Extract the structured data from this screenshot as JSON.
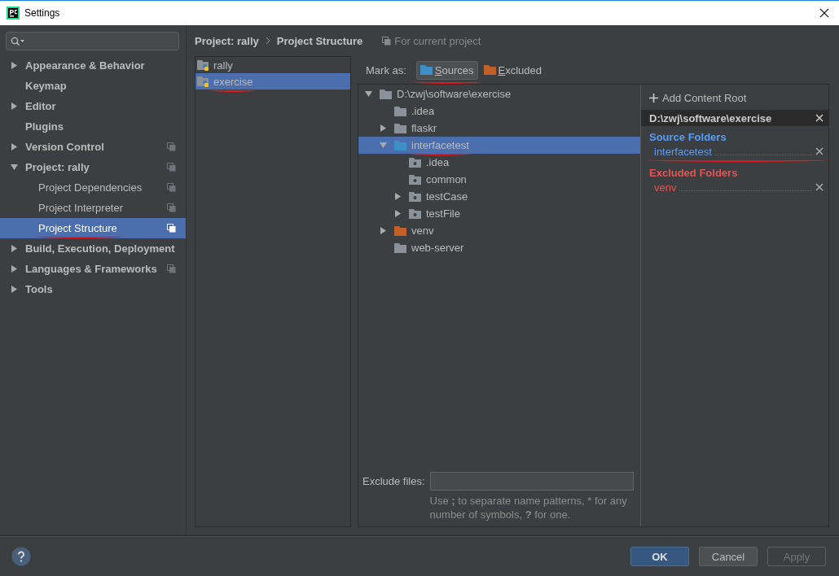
{
  "window": {
    "title": "Settings"
  },
  "sidebar": {
    "items": [
      {
        "label": "Appearance & Behavior",
        "expanded": false,
        "selected": false,
        "project_scope": false,
        "underlined": false
      },
      {
        "label": "Keymap",
        "selected": false,
        "project_scope": false,
        "underlined": false
      },
      {
        "label": "Editor",
        "expanded": false,
        "selected": false,
        "project_scope": false,
        "underlined": false
      },
      {
        "label": "Plugins",
        "selected": false,
        "project_scope": false,
        "underlined": false
      },
      {
        "label": "Version Control",
        "expanded": false,
        "selected": false,
        "project_scope": true,
        "underlined": false
      },
      {
        "label": "Project: rally",
        "expanded": true,
        "selected": false,
        "project_scope": true,
        "underlined": false,
        "children": [
          {
            "label": "Project Dependencies",
            "selected": false,
            "project_scope": true,
            "underlined": false
          },
          {
            "label": "Project Interpreter",
            "selected": false,
            "project_scope": true,
            "underlined": false
          },
          {
            "label": "Project Structure",
            "selected": true,
            "project_scope": true,
            "underlined": true
          }
        ]
      },
      {
        "label": "Build, Execution, Deployment",
        "expanded": false,
        "selected": false,
        "project_scope": false,
        "underlined": false
      },
      {
        "label": "Languages & Frameworks",
        "expanded": false,
        "selected": false,
        "project_scope": true,
        "underlined": false
      },
      {
        "label": "Tools",
        "expanded": false,
        "selected": false,
        "project_scope": false,
        "underlined": false
      }
    ]
  },
  "breadcrumb": [
    "Project: rally",
    "Project Structure"
  ],
  "scope_note": "For current project",
  "modules": [
    {
      "name": "rally",
      "selected": false,
      "underlined": false
    },
    {
      "name": "exercise",
      "selected": true,
      "underlined": true
    }
  ],
  "mark_as": {
    "label": "Mark as:",
    "buttons": [
      {
        "label": "Sources",
        "kind": "source",
        "selected": true,
        "underlined": true
      },
      {
        "label": "Excluded",
        "kind": "excluded",
        "selected": false,
        "underlined": false
      }
    ]
  },
  "tree": [
    {
      "name": "D:\\zwj\\software\\exercise",
      "kind": "folder",
      "expanded": true,
      "selected": false,
      "underlined": false,
      "children": [
        {
          "name": ".idea",
          "kind": "folder",
          "selected": false,
          "underlined": false
        },
        {
          "name": "flaskr",
          "kind": "folder",
          "expanded": false,
          "selected": false,
          "underlined": false
        },
        {
          "name": "interfacetest",
          "kind": "source",
          "expanded": true,
          "selected": true,
          "underlined": true,
          "children": [
            {
              "name": ".idea",
              "kind": "package",
              "selected": false,
              "underlined": false
            },
            {
              "name": "common",
              "kind": "package",
              "selected": false,
              "underlined": false
            },
            {
              "name": "testCase",
              "kind": "package",
              "expanded": false,
              "selected": false,
              "underlined": false
            },
            {
              "name": "testFile",
              "kind": "package",
              "expanded": false,
              "selected": false,
              "underlined": false
            }
          ]
        },
        {
          "name": "venv",
          "kind": "excluded",
          "expanded": false,
          "selected": false,
          "underlined": false
        },
        {
          "name": "web-server",
          "kind": "folder",
          "selected": false,
          "underlined": false
        }
      ]
    }
  ],
  "exclude_files": {
    "label": "Exclude files:",
    "hint": [
      {
        "text": "Use ",
        "bold": false
      },
      {
        "text": ";",
        "bold": true
      },
      {
        "text": " to separate name patterns, * for any number of symbols, ",
        "bold": false
      },
      {
        "text": "?",
        "bold": true
      },
      {
        "text": " for one.",
        "bold": false
      }
    ]
  },
  "roots": {
    "add_label": "Add Content Root",
    "root": "D:\\zwj\\software\\exercise",
    "sections": [
      {
        "title": "Source Folders",
        "kind": "source",
        "folders": [
          {
            "name": "interfacetest",
            "underlined": true
          }
        ]
      },
      {
        "title": "Excluded Folders",
        "kind": "excluded",
        "folders": [
          {
            "name": "venv",
            "underlined": false
          }
        ]
      }
    ]
  },
  "buttons": [
    {
      "label": "OK",
      "kind": "primary",
      "disabled": false
    },
    {
      "label": "Cancel",
      "kind": "normal",
      "disabled": false
    },
    {
      "label": "Apply",
      "kind": "normal",
      "disabled": true
    }
  ]
}
